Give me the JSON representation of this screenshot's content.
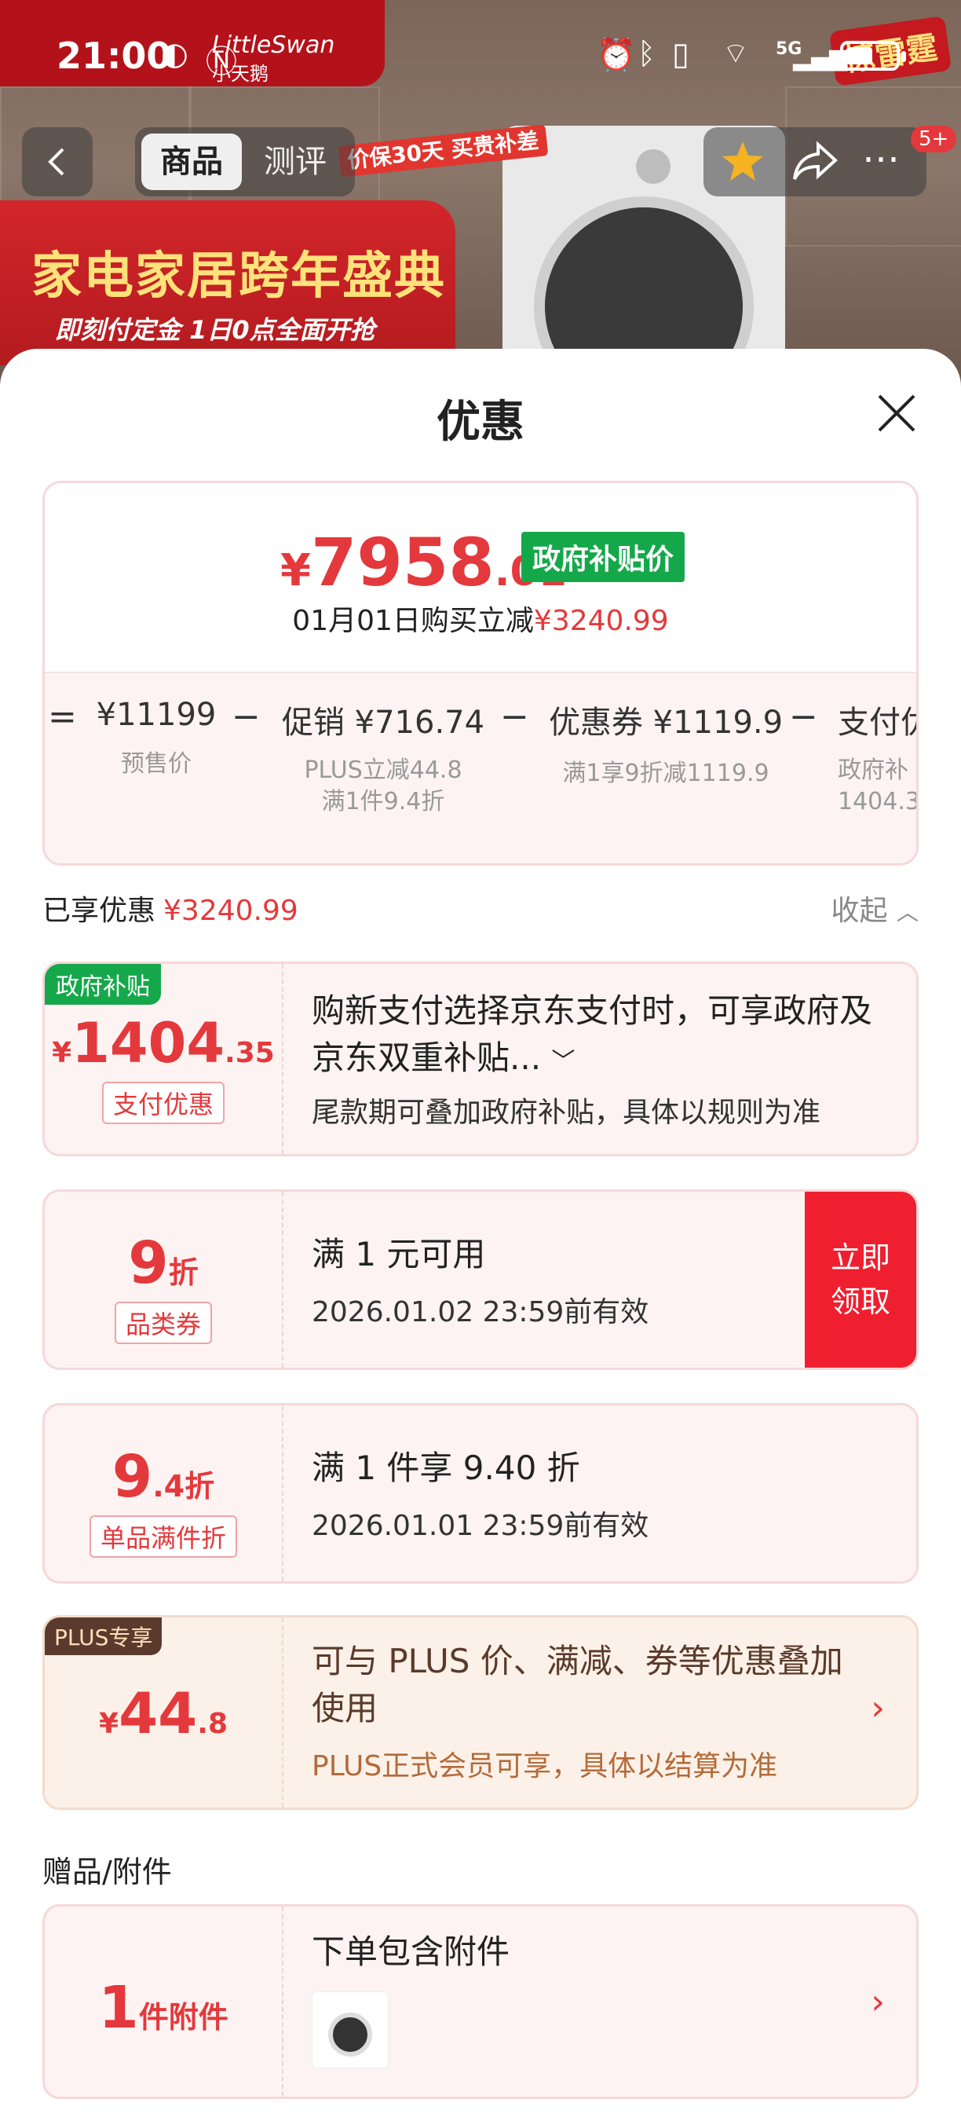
{
  "status_bar": {
    "time": "21:00",
    "network": "5G"
  },
  "background": {
    "brand": "LittleSwan",
    "brand_cn": "小天鹅",
    "sale_title": "家电家居跨年盛典",
    "sale_subtitle": "即刻付定金 1日0点全面开抢",
    "promo_badge": "价保30天 买贵补差",
    "hot_badge": "惊雷霆"
  },
  "header": {
    "tabs": [
      {
        "label": "商品",
        "active": true
      },
      {
        "label": "测评",
        "active": false
      }
    ],
    "notification_count": "5+"
  },
  "sheet": {
    "title": "优惠",
    "price": {
      "currency": "¥",
      "integer": "7958",
      "decimal": ".01",
      "tag": "政府补贴价",
      "buy_date": "01月01日购买立减",
      "buy_discount": "¥3240.99"
    },
    "breakdown": {
      "equals": "=",
      "items": [
        {
          "main": "¥11199",
          "sub1": "预售价",
          "sub2": ""
        },
        {
          "main": "促销 ¥716.74",
          "sub1": "PLUS立减44.8",
          "sub2": "满1件9.4折"
        },
        {
          "main": "优惠券 ¥1119.9",
          "sub1": "满1享9折减1119.9",
          "sub2": ""
        },
        {
          "main": "支付优",
          "sub1": "政府补",
          "sub2": "1404.3"
        }
      ],
      "minus": "−"
    },
    "summary": {
      "label": "已享优惠",
      "value": "¥3240.99",
      "collapse_label": "收起"
    },
    "coupons": [
      {
        "corner_tag": "政府补贴",
        "amount_currency": "¥",
        "amount_int": "1404",
        "amount_dec": ".35",
        "pill": "支付优惠",
        "title": "购新支付选择京东支付时，可享政府及京东双重补贴...",
        "sub": "尾款期可叠加政府补贴，具体以规则为准"
      },
      {
        "amount_int": "9",
        "amount_unit": "折",
        "pill": "品类券",
        "title": "满 1 元可用",
        "sub": "2026.01.02 23:59前有效",
        "claim": "立即领取"
      },
      {
        "amount_int": "9",
        "amount_dec": ".4",
        "amount_unit": "折",
        "pill": "单品满件折",
        "title": "满 1 件享 9.40 折",
        "sub": "2026.01.01 23:59前有效"
      },
      {
        "corner_tag": "PLUS专享",
        "amount_currency": "¥",
        "amount_int": "44",
        "amount_dec": ".8",
        "title": "可与 PLUS 价、满减、券等优惠叠加使用",
        "sub": "PLUS正式会员可享，具体以结算为准"
      }
    ],
    "gifts": {
      "section_label": "赠品/附件",
      "amount_int": "1",
      "amount_unit": "件附件",
      "title": "下单包含附件"
    }
  },
  "colors": {
    "accent_red": "#e4393c",
    "gov_green": "#15a84a",
    "claim_red": "#ef1f2f",
    "plus_brown": "#5b3a2e"
  }
}
